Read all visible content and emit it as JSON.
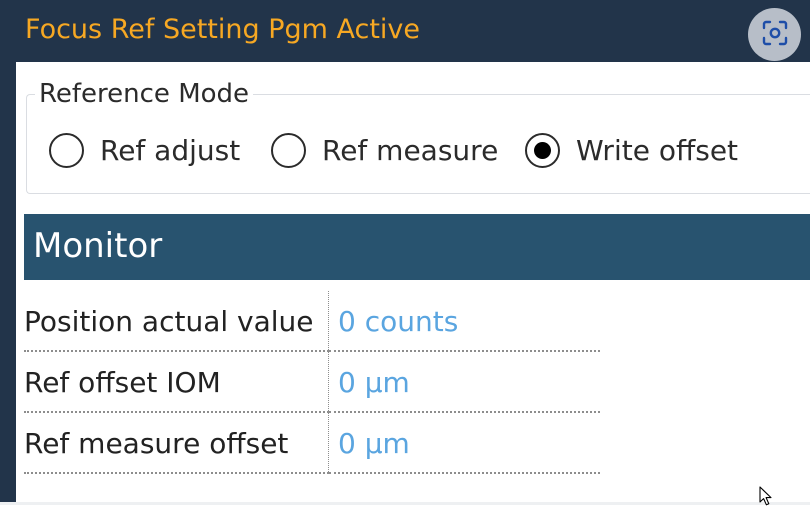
{
  "window": {
    "title": "Focus Ref Setting Pgm Active",
    "title_color": "#f7a823",
    "titlebar_color": "#22344a",
    "capture_icon": "screen-capture-icon"
  },
  "reference_mode": {
    "legend": "Reference Mode",
    "options": [
      {
        "label": "Ref adjust",
        "checked": false
      },
      {
        "label": "Ref measure",
        "checked": false
      },
      {
        "label": "Write offset",
        "checked": true
      }
    ]
  },
  "monitor": {
    "title": "Monitor",
    "header_color": "#28536f",
    "value_color": "#5aa5e0",
    "rows": [
      {
        "label": "Position actual value",
        "value": "0 counts"
      },
      {
        "label": "Ref offset IOM",
        "value": "0 µm"
      },
      {
        "label": "Ref measure offset",
        "value": "0 µm"
      }
    ]
  }
}
